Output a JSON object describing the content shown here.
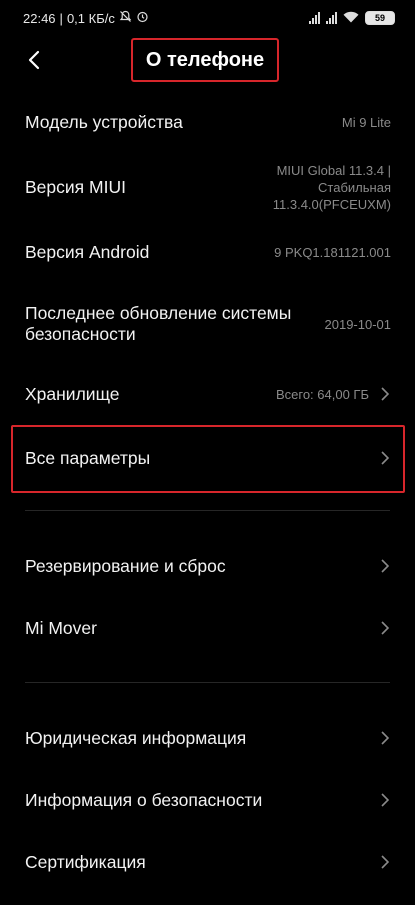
{
  "status_bar": {
    "time": "22:46",
    "speed": "0,1 КБ/с",
    "battery": "59"
  },
  "header": {
    "title": "О телефоне"
  },
  "rows": [
    {
      "label": "Модель устройства",
      "value": "Mi 9 Lite"
    },
    {
      "label": "Версия MIUI",
      "value_lines": [
        "MIUI Global 11.3.4 |",
        "Стабильная",
        "11.3.4.0(PFCEUXM)"
      ]
    },
    {
      "label": "Версия Android",
      "value": "9 PKQ1.181121.001"
    },
    {
      "label_lines": [
        "Последнее обновление системы",
        "безопасности"
      ],
      "value": "2019-10-01"
    },
    {
      "label": "Хранилище",
      "value": "Всего: 64,00 ГБ"
    },
    {
      "label": "Все параметры"
    }
  ],
  "rows2": [
    {
      "label": "Резервирование и сброс"
    },
    {
      "label": "Mi Mover"
    }
  ],
  "rows3": [
    {
      "label": "Юридическая информация"
    },
    {
      "label": "Информация о безопасности"
    },
    {
      "label": "Сертификация"
    }
  ],
  "colors": {
    "highlight": "#d7262b",
    "value_text": "#8a8a8a"
  }
}
